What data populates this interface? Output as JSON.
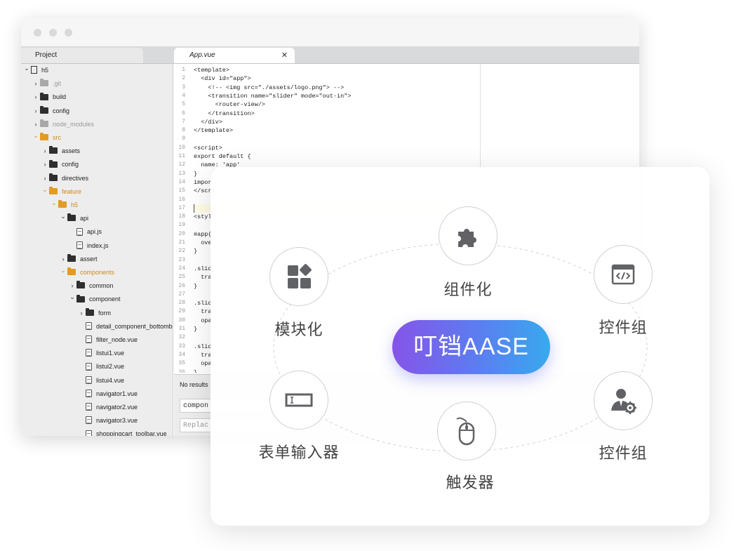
{
  "editor": {
    "project_tab": "Project",
    "file_tab": "App.vue",
    "close_glyph": "✕",
    "tree": [
      {
        "name": "h5",
        "depth": 0,
        "type": "book",
        "state": "open",
        "tone": "normal"
      },
      {
        "name": ".git",
        "depth": 1,
        "type": "folder",
        "state": "closed",
        "tone": "dim"
      },
      {
        "name": "build",
        "depth": 1,
        "type": "folder",
        "state": "closed",
        "tone": "normal"
      },
      {
        "name": "config",
        "depth": 1,
        "type": "folder",
        "state": "closed",
        "tone": "normal"
      },
      {
        "name": "node_modules",
        "depth": 1,
        "type": "folder",
        "state": "closed",
        "tone": "dim"
      },
      {
        "name": "src",
        "depth": 1,
        "type": "folder",
        "state": "open",
        "tone": "orange"
      },
      {
        "name": "assets",
        "depth": 2,
        "type": "folder",
        "state": "closed",
        "tone": "normal"
      },
      {
        "name": "config",
        "depth": 2,
        "type": "folder",
        "state": "closed",
        "tone": "normal"
      },
      {
        "name": "directives",
        "depth": 2,
        "type": "folder",
        "state": "closed",
        "tone": "normal"
      },
      {
        "name": "feature",
        "depth": 2,
        "type": "folder",
        "state": "open",
        "tone": "orange"
      },
      {
        "name": "h5",
        "depth": 3,
        "type": "folder",
        "state": "open",
        "tone": "orange"
      },
      {
        "name": "api",
        "depth": 4,
        "type": "folder",
        "state": "open",
        "tone": "normal"
      },
      {
        "name": "api.js",
        "depth": 5,
        "type": "file",
        "state": "none",
        "tone": "normal"
      },
      {
        "name": "index.js",
        "depth": 5,
        "type": "file",
        "state": "none",
        "tone": "normal"
      },
      {
        "name": "assert",
        "depth": 4,
        "type": "folder",
        "state": "closed",
        "tone": "normal"
      },
      {
        "name": "components",
        "depth": 4,
        "type": "folder",
        "state": "open",
        "tone": "orange"
      },
      {
        "name": "common",
        "depth": 5,
        "type": "folder",
        "state": "closed",
        "tone": "normal"
      },
      {
        "name": "component",
        "depth": 5,
        "type": "folder",
        "state": "open",
        "tone": "normal"
      },
      {
        "name": "form",
        "depth": 6,
        "type": "folder",
        "state": "closed",
        "tone": "normal"
      },
      {
        "name": "detail_component_bottomb",
        "depth": 6,
        "type": "file",
        "state": "none",
        "tone": "normal"
      },
      {
        "name": "filter_node.vue",
        "depth": 6,
        "type": "file",
        "state": "none",
        "tone": "normal"
      },
      {
        "name": "listui1.vue",
        "depth": 6,
        "type": "file",
        "state": "none",
        "tone": "normal"
      },
      {
        "name": "listui2.vue",
        "depth": 6,
        "type": "file",
        "state": "none",
        "tone": "normal"
      },
      {
        "name": "listui4.vue",
        "depth": 6,
        "type": "file",
        "state": "none",
        "tone": "normal"
      },
      {
        "name": "navigator1.vue",
        "depth": 6,
        "type": "file",
        "state": "none",
        "tone": "normal"
      },
      {
        "name": "navigator2.vue",
        "depth": 6,
        "type": "file",
        "state": "none",
        "tone": "normal"
      },
      {
        "name": "navigator3.vue",
        "depth": 6,
        "type": "file",
        "state": "none",
        "tone": "normal"
      },
      {
        "name": "shoppingcart_toolbar.vue",
        "depth": 6,
        "type": "file",
        "state": "none",
        "tone": "normal"
      }
    ],
    "code_lines": [
      {
        "n": "1",
        "t": "<template>"
      },
      {
        "n": "2",
        "t": "  <div id=\"app\">"
      },
      {
        "n": "3",
        "t": "    <!-- <img src=\"./assets/logo.png\"> -->"
      },
      {
        "n": "4",
        "t": "    <transition name=\"slider\" mode=\"out-in\">"
      },
      {
        "n": "5",
        "t": "      <router-view/>"
      },
      {
        "n": "6",
        "t": "    </transition>"
      },
      {
        "n": "7",
        "t": "  </div>"
      },
      {
        "n": "8",
        "t": "</template>"
      },
      {
        "n": "9",
        "t": ""
      },
      {
        "n": "10",
        "t": "<script>"
      },
      {
        "n": "11",
        "t": "export default {"
      },
      {
        "n": "12",
        "t": "  name: 'app'"
      },
      {
        "n": "13",
        "t": "}"
      },
      {
        "n": "14",
        "t": "impor"
      },
      {
        "n": "15",
        "t": "</scri"
      },
      {
        "n": "16",
        "t": ""
      },
      {
        "n": "17",
        "t": ""
      },
      {
        "n": "18",
        "t": "<styl"
      },
      {
        "n": "19",
        "t": ""
      },
      {
        "n": "20",
        "t": "#app{"
      },
      {
        "n": "21",
        "t": "  ove"
      },
      {
        "n": "22",
        "t": "}"
      },
      {
        "n": "23",
        "t": ""
      },
      {
        "n": "24",
        "t": ".slid"
      },
      {
        "n": "25",
        "t": "  tra"
      },
      {
        "n": "26",
        "t": "}"
      },
      {
        "n": "27",
        "t": ""
      },
      {
        "n": "28",
        "t": ".slid"
      },
      {
        "n": "29",
        "t": "  tra"
      },
      {
        "n": "30",
        "t": "  opa"
      },
      {
        "n": "31",
        "t": "}"
      },
      {
        "n": "32",
        "t": ""
      },
      {
        "n": "33",
        "t": ".slid"
      },
      {
        "n": "34",
        "t": "  tra"
      },
      {
        "n": "35",
        "t": "  opa"
      },
      {
        "n": "36",
        "t": "}"
      }
    ],
    "find_status": "No results",
    "find_value": "compon",
    "replace_placeholder": "Replac"
  },
  "card": {
    "center_label": "叮铛AASE",
    "nodes": [
      {
        "id": "top",
        "label": "组件化",
        "icon": "puzzle-icon"
      },
      {
        "id": "left-top",
        "label": "模块化",
        "icon": "modules-icon"
      },
      {
        "id": "right-top",
        "label": "控件组",
        "icon": "code-window-icon"
      },
      {
        "id": "left-bottom",
        "label": "表单输入器",
        "icon": "input-field-icon"
      },
      {
        "id": "bottom",
        "label": "触发器",
        "icon": "mouse-icon"
      },
      {
        "id": "right-bottom",
        "label": "控件组",
        "icon": "user-gear-icon"
      }
    ]
  },
  "colors": {
    "folder_open": "#e39b22",
    "gradient_start": "#8654e8",
    "gradient_end": "#38a9ee",
    "icon_gray": "#606266"
  }
}
